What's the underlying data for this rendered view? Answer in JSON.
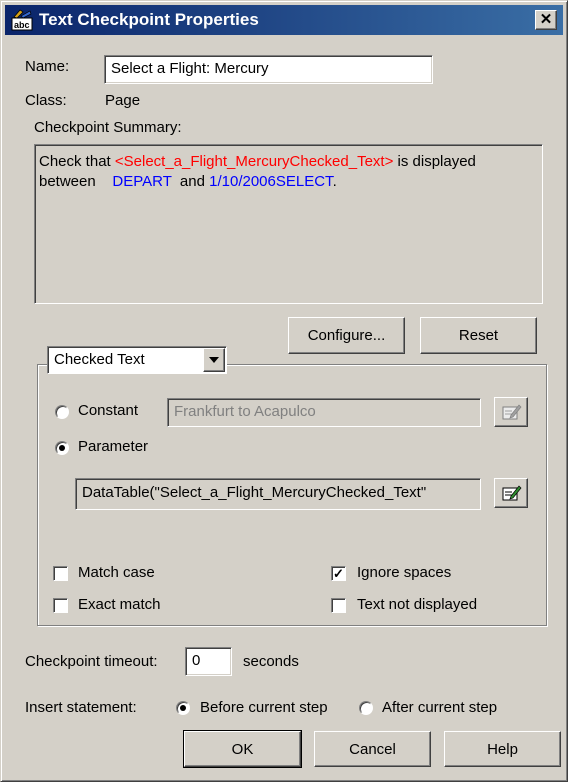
{
  "window": {
    "title": "Text Checkpoint Properties",
    "close_glyph": "✕"
  },
  "name_label": "Name:",
  "name_value": "Select a Flight: Mercury",
  "class_label": "Class:",
  "class_value": "Page",
  "summary_label": "Checkpoint Summary:",
  "summary": {
    "part1": "Check that ",
    "param": "<Select_a_Flight_MercuryChecked_Text>",
    "part2": " is displayed",
    "part3": "between ",
    "before_text": "DEPART ",
    "part4": " and ",
    "after_text": "1/10/2006SELECT",
    "part5": "."
  },
  "configure_label": "Configure...",
  "reset_label": "Reset",
  "text_type_select": "Checked Text",
  "constant_label": "Constant",
  "constant_value": "Frankfurt to Acapulco",
  "parameter_label": "Parameter",
  "parameter_value": "DataTable(\"Select_a_Flight_MercuryChecked_Text\"",
  "options": {
    "match_case": "Match case",
    "exact_match": "Exact match",
    "ignore_spaces": "Ignore spaces",
    "text_not_displayed": "Text not displayed"
  },
  "timeout_label": "Checkpoint timeout:",
  "timeout_value": "0",
  "timeout_unit": "seconds",
  "insert_label": "Insert statement:",
  "insert_before": "Before current step",
  "insert_after": "After current step",
  "ok_label": "OK",
  "cancel_label": "Cancel",
  "help_label": "Help",
  "colors": {
    "param": "#ff0000",
    "value": "#0000ff",
    "titlebar": "#0a246a"
  },
  "icons": [
    "text-checkpoint-icon",
    "close-icon",
    "edit-value-icon",
    "dropdown-arrow-icon"
  ]
}
